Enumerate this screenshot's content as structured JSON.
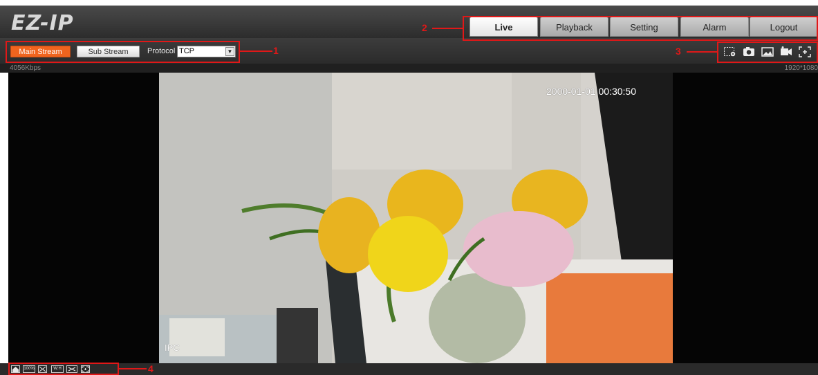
{
  "app": {
    "logo": "EZ-IP"
  },
  "nav": {
    "tabs": [
      {
        "label": "Live",
        "active": true
      },
      {
        "label": "Playback",
        "active": false
      },
      {
        "label": "Setting",
        "active": false
      },
      {
        "label": "Alarm",
        "active": false
      },
      {
        "label": "Logout",
        "active": false
      }
    ]
  },
  "stream": {
    "main_label": "Main Stream",
    "sub_label": "Sub Stream",
    "protocol_label": "Protocol",
    "protocol_value": "TCP"
  },
  "toolbar_icons": [
    "zoom-region-icon",
    "snapshot-icon",
    "picture-icon",
    "record-icon",
    "fullscreen-icon"
  ],
  "status": {
    "bitrate": "4056Kbps",
    "resolution": "1920*1080"
  },
  "video": {
    "timestamp": "2000-01-01 00:30:50",
    "channel_label": "IPC"
  },
  "bottom_bar": {
    "icons": [
      {
        "name": "home-icon",
        "text": ""
      },
      {
        "name": "original-size-icon",
        "text": "100%"
      },
      {
        "name": "fit-window-icon",
        "text": ""
      },
      {
        "name": "aspect-ratio-icon",
        "text": "W:H"
      },
      {
        "name": "smooth-icon",
        "text": ""
      },
      {
        "name": "full-screen-icon",
        "text": ""
      }
    ]
  },
  "callouts": [
    "1",
    "2",
    "3",
    "4"
  ],
  "colors": {
    "accent": "#f0641e",
    "callout": "#e01818",
    "header": "#2c2c2c"
  }
}
